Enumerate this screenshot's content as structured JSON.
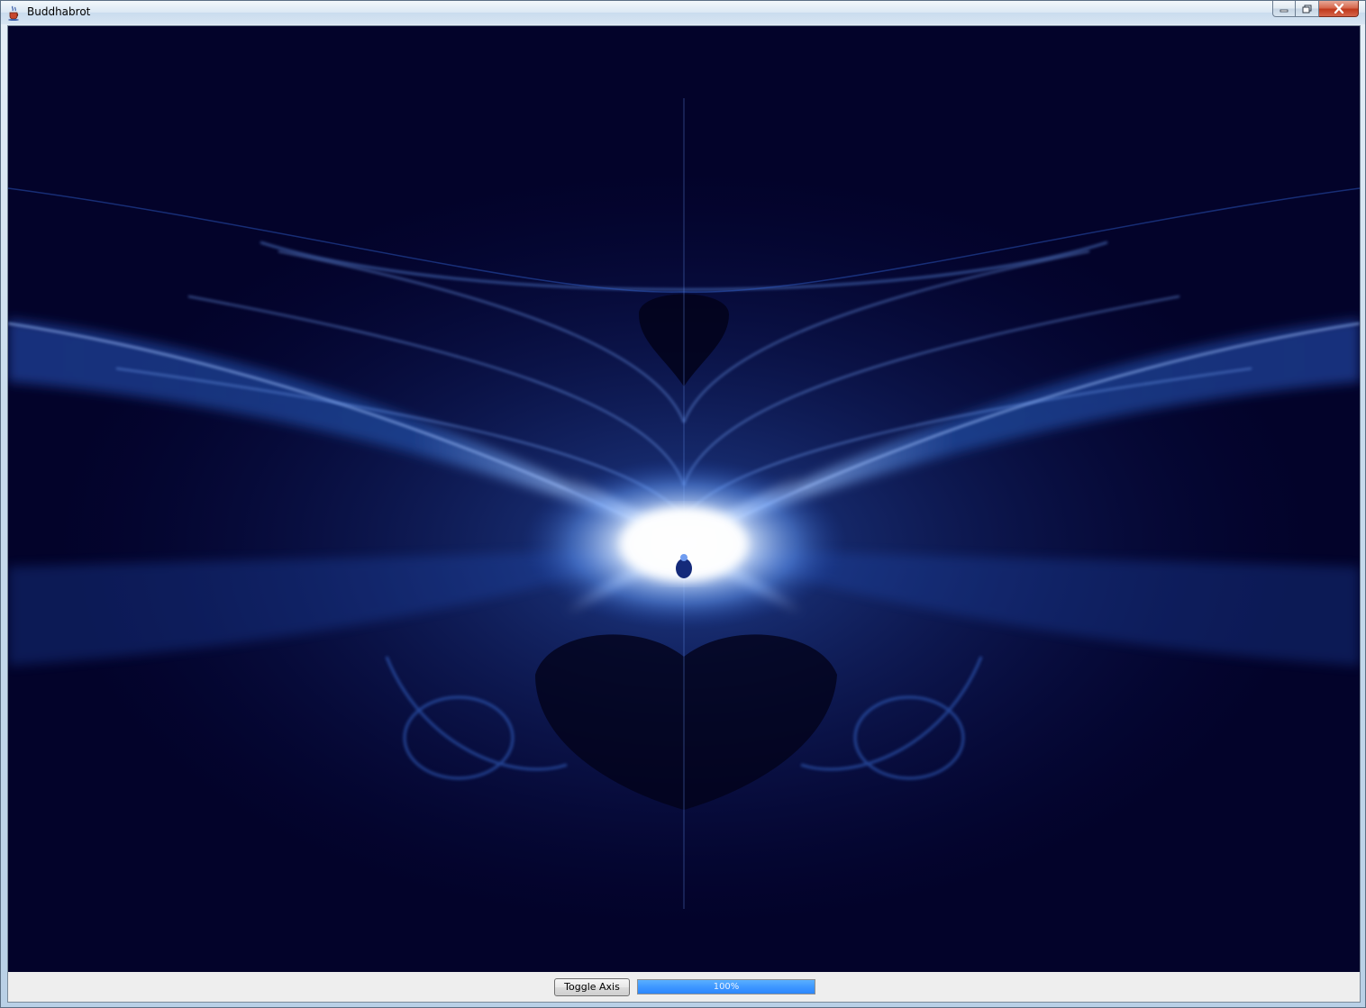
{
  "window": {
    "title": "Buddhabrot"
  },
  "controls": {
    "toggle_axis_label": "Toggle Axis",
    "progress_value": 100,
    "progress_label": "100%"
  },
  "colors": {
    "canvas_background": "#03032a",
    "glow_blue": "#2f6fd8",
    "core_white": "#ffffff",
    "progress_fill": "#3f98ff"
  }
}
